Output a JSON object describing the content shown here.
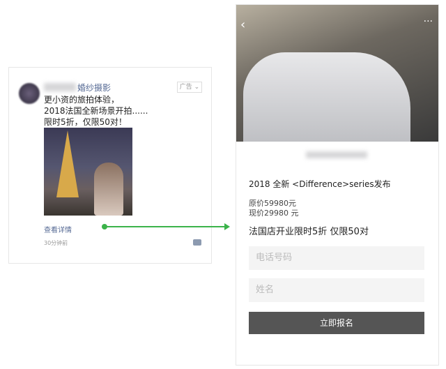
{
  "ad_card": {
    "name": "婚纱摄影",
    "ad_label": "广告 ⌄",
    "lines": [
      "更小资的旅拍体验，",
      "2018法国全新场景开拍......",
      "限时5折，仅限50对！"
    ],
    "more": "查看详情",
    "time": "30分钟前"
  },
  "landing": {
    "title": "2018 全新 <Difference>series发布",
    "original_price": "原价59980元",
    "current_price": "现价29980 元",
    "promo": "法国店开业限时5折 仅限50对",
    "phone_placeholder": "电话号码",
    "name_placeholder": "姓名",
    "submit": "立即报名",
    "back": "‹",
    "menu": "···"
  },
  "colors": {
    "arrow": "#3bb34a",
    "button": "#555555"
  }
}
